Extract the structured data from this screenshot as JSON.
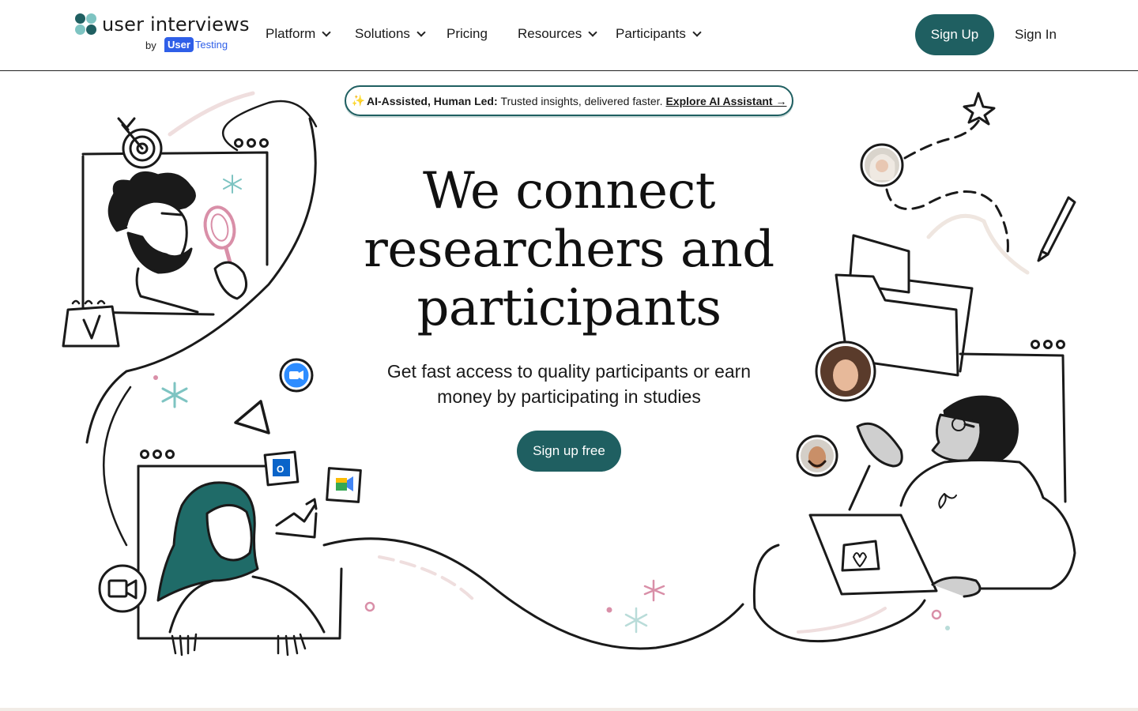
{
  "brand": {
    "name": "user interviews",
    "by": "by",
    "parent_user": "User",
    "parent_testing": "Testing",
    "colors": {
      "primary": "#1f5f61",
      "parent_blue": "#2f5fe8",
      "accent_pink": "#d98fa8",
      "accent_teal": "#7ec4c2"
    }
  },
  "nav": {
    "items": [
      {
        "label": "Platform",
        "has_dropdown": true,
        "icon": "chevron-down-icon"
      },
      {
        "label": "Solutions",
        "has_dropdown": true,
        "icon": "chevron-down-icon"
      },
      {
        "label": "Pricing",
        "has_dropdown": false
      },
      {
        "label": "Resources",
        "has_dropdown": true,
        "icon": "chevron-down-icon"
      },
      {
        "label": "Participants",
        "has_dropdown": true,
        "icon": "chevron-down-icon"
      }
    ],
    "signup_label": "Sign Up",
    "signin_label": "Sign In"
  },
  "banner": {
    "sparkle": "✨",
    "bold": "AI-Assisted, Human Led:",
    "text": "Trusted insights, delivered faster.",
    "link": "Explore AI Assistant →"
  },
  "hero": {
    "headline": "We connect researchers and participants",
    "subheadline": "Get fast access to quality participants or earn money by participating in studies",
    "cta_label": "Sign up free"
  },
  "illustration_icons": [
    "target-icon",
    "magnifier-icon",
    "calendar-icon",
    "zoom-icon",
    "outlook-icon",
    "google-meet-icon",
    "video-camera-icon",
    "star-icon",
    "pencil-icon",
    "folder-icon",
    "laptop-icon",
    "heart-icon",
    "chart-icon"
  ]
}
